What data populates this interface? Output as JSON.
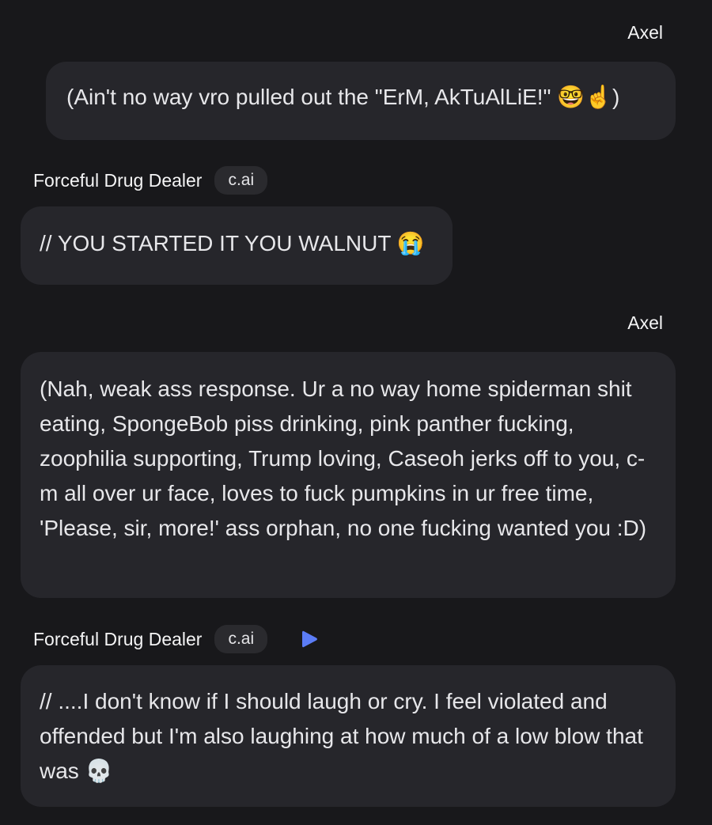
{
  "messages": [
    {
      "sender": "Axel",
      "text": "(Ain't no way vro pulled out the \"ErM, AkTuAlLiE!\" 🤓☝️)"
    },
    {
      "sender": "Forceful Drug Dealer",
      "badge": "c.ai",
      "text": "// YOU STARTED IT YOU WALNUT 😭"
    },
    {
      "sender": "Axel",
      "text": "(Nah, weak ass response. Ur a no way home spiderman shit eating, SpongeBob piss drinking, pink panther fucking, zoophilia supporting, Trump loving, Caseoh jerks off to you, c-m all over ur face, loves to fuck pumpkins in ur free time, 'Please, sir, more!' ass orphan, no one fucking wanted you :D)"
    },
    {
      "sender": "Forceful Drug Dealer",
      "badge": "c.ai",
      "icon": "play-icon",
      "text": "// ....I don't know if I should laugh or cry. I feel violated and offended but I'm also laughing at how much of a low blow that was 💀"
    }
  ],
  "colors": {
    "background": "#18181b",
    "bubble": "#26262b",
    "badge": "#2a2a2e",
    "accent": "#5b7cf6"
  }
}
